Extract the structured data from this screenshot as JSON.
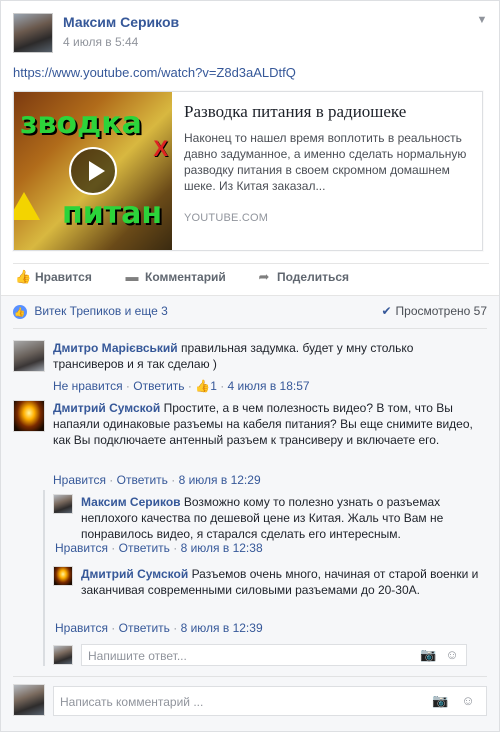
{
  "post": {
    "author": "Максим Сериков",
    "time": "4 июля в 5:44",
    "url": "https://www.youtube.com/watch?v=Z8d3aALDtfQ",
    "preview": {
      "title": "Разводка питания в радиошеке",
      "description": "Наконец то нашел время воплотить в реальность давно задуманное, а именно сделать нормальную разводку питания в своем скромном домашнем шеке. Из Китая заказал...",
      "domain": "YOUTUBE.COM",
      "thumb_text_top": "зводка",
      "thumb_text_bottom": "питан",
      "thumb_text_side": "Х"
    }
  },
  "actions": {
    "like": "Нравится",
    "comment": "Комментарий",
    "share": "Поделиться"
  },
  "likes": {
    "text": "Витек Трепиков и еще 3",
    "seen": "Просмотрено 57"
  },
  "comments": [
    {
      "author": "Дмитро Марієвський",
      "text": "правильная задумка. будет у мну столько трансиверов и я так сделаю )",
      "unlike": "Не нравится",
      "reply": "Ответить",
      "like_count": "1",
      "time": "4 июля в 18:57"
    },
    {
      "author": "Дмитрий Сумской",
      "text": "Простите, а в чем полезность видео? В том, что Вы напаяли одинаковые разъемы на кабеля питания? Вы еще снимите видео, как Вы подключаете антенный разъем к трансиверу и включаете его.",
      "like": "Нравится",
      "reply": "Ответить",
      "time": "8 июля в 12:29",
      "replies": [
        {
          "author": "Максим Сериков",
          "text": "Возможно кому то полезно узнать о разъемах неплохого качества по дешевой цене из Китая. Жаль что Вам не понравилось видео, я старался сделать его интересным.",
          "like": "Нравится",
          "reply": "Ответить",
          "time": "8 июля в 12:38"
        },
        {
          "author": "Дмитрий Сумской",
          "text": "Разъемов очень много, начиная от старой военки и заканчивая современными силовыми разъемами до 20-30А.",
          "like": "Нравится",
          "reply": "Ответить",
          "time": "8 июля в 12:39"
        }
      ],
      "reply_placeholder": "Напишите ответ..."
    }
  ],
  "comment_placeholder": "Написать комментарий ...",
  "icons": {
    "chevron": "chevron-down-icon",
    "like": "thumbs-up-icon",
    "comment": "speech-bubble-icon",
    "share": "share-arrow-icon",
    "check": "checkmark-icon",
    "camera": "camera-icon",
    "smile": "emoji-icon"
  },
  "colors": {
    "link": "#365899",
    "meta": "#90949c",
    "bg": "#f6f7f9"
  }
}
